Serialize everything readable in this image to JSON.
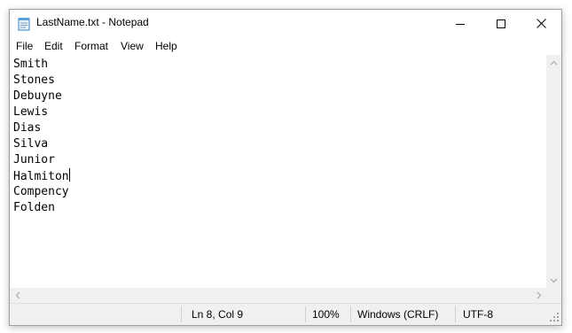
{
  "window": {
    "title": "LastName.txt - Notepad"
  },
  "menu": [
    "File",
    "Edit",
    "Format",
    "View",
    "Help"
  ],
  "editor": {
    "lines": [
      "Smith",
      "Stones",
      "Debuyne",
      "Lewis",
      "Dias",
      "Silva",
      "Junior",
      "Halmiton",
      "Compency",
      "Folden"
    ],
    "caret": "after Halmiton"
  },
  "statusbar": {
    "position": "Ln 8, Col 9",
    "zoom": "100%",
    "line_ending": "Windows (CRLF)",
    "encoding": "UTF-8"
  },
  "icons": {
    "app": "notepad-icon",
    "minimize": "minimize-icon",
    "maximize": "maximize-icon",
    "close": "close-icon"
  }
}
